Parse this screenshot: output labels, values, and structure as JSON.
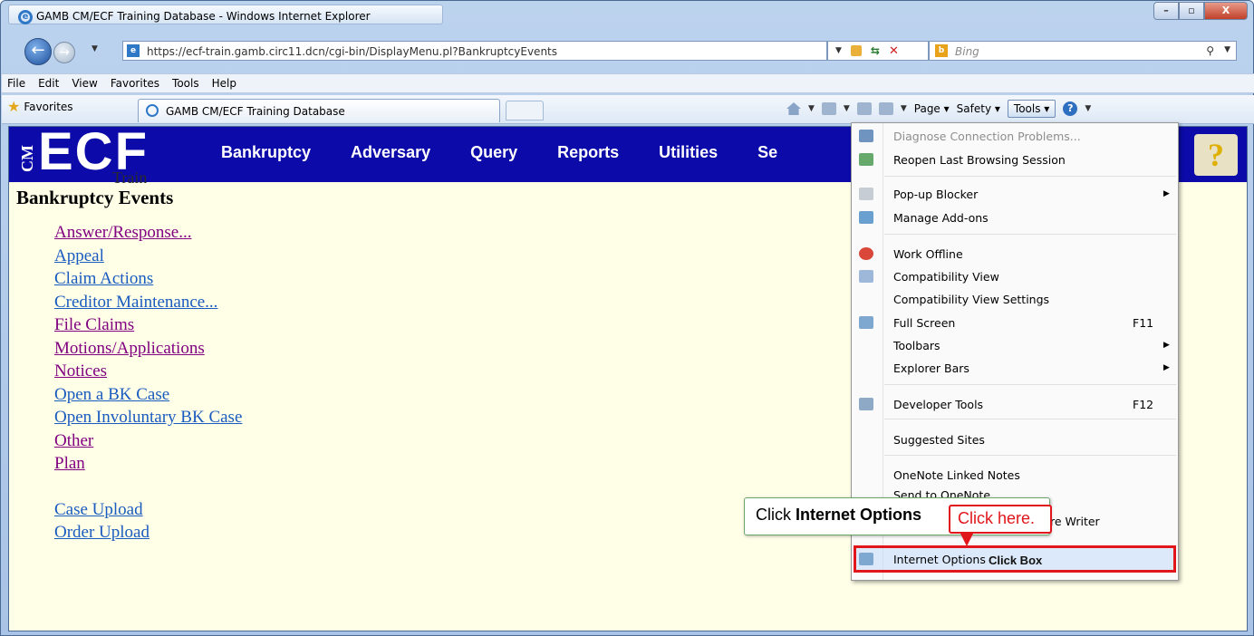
{
  "window": {
    "title": "GAMB CM/ECF Training Database - Windows Internet Explorer",
    "controls": {
      "minimize": "–",
      "maximize": "▫",
      "close": "X"
    }
  },
  "nav": {
    "address": "https://ecf-train.gamb.circ11.dcn/cgi-bin/DisplayMenu.pl?BankruptcyEvents",
    "search_placeholder": "Bing"
  },
  "menubar": [
    "File",
    "Edit",
    "View",
    "Favorites",
    "Tools",
    "Help"
  ],
  "favbar": {
    "favorites_label": "Favorites",
    "tab_title": "GAMB CM/ECF Training Database",
    "page_label": "Page",
    "safety_label": "Safety",
    "tools_label": "Tools"
  },
  "ecf": {
    "logo_cm": "CM",
    "logo_ecf": "ECF",
    "logo_train": "Train",
    "menu": [
      "Bankruptcy",
      "Adversary",
      "Query",
      "Reports",
      "Utilities",
      "Se"
    ],
    "help": "?"
  },
  "page": {
    "heading": "Bankruptcy Events",
    "links": [
      {
        "label": "Answer/Response...",
        "visited": true
      },
      {
        "label": "Appeal",
        "visited": false
      },
      {
        "label": "Claim Actions",
        "visited": false
      },
      {
        "label": "Creditor Maintenance...",
        "visited": false
      },
      {
        "label": "File Claims",
        "visited": true
      },
      {
        "label": "Motions/Applications",
        "visited": true
      },
      {
        "label": "Notices",
        "visited": true
      },
      {
        "label": "Open a BK Case",
        "visited": false
      },
      {
        "label": "Open Involuntary BK Case",
        "visited": false
      },
      {
        "label": "Other",
        "visited": true
      },
      {
        "label": "Plan",
        "visited": true
      }
    ],
    "upload_links": [
      {
        "label": "Case Upload",
        "visited": false
      },
      {
        "label": "Order Upload",
        "visited": false
      }
    ]
  },
  "tools_menu": {
    "items": {
      "diagnose": "Diagnose Connection Problems...",
      "reopen": "Reopen Last Browsing Session",
      "popup": "Pop-up Blocker",
      "addons": "Manage Add-ons",
      "offline": "Work Offline",
      "compat": "Compatibility View",
      "compat_settings": "Compatibility View Settings",
      "fullscreen": "Full Screen",
      "fullscreen_key": "F11",
      "toolbars": "Toolbars",
      "explorer_bars": "Explorer Bars",
      "devtools": "Developer Tools",
      "devtools_key": "F12",
      "suggested": "Suggested Sites",
      "onenote_linked": "OneNote Linked Notes",
      "onenote_send": "Send to OneNote",
      "writer_partial": "re Writer",
      "internet_options": "Internet Options"
    }
  },
  "callouts": {
    "main_prefix": "Click ",
    "main_bold": "Internet Options",
    "here": "Click here.",
    "click_box": "Click Box"
  },
  "colors": {
    "ecf_blue": "#0c0aa8",
    "content_bg": "#ffffe8",
    "visited_link": "#800080",
    "unvisited_link": "#1a5bbf",
    "highlight_red": "#e0161a"
  }
}
